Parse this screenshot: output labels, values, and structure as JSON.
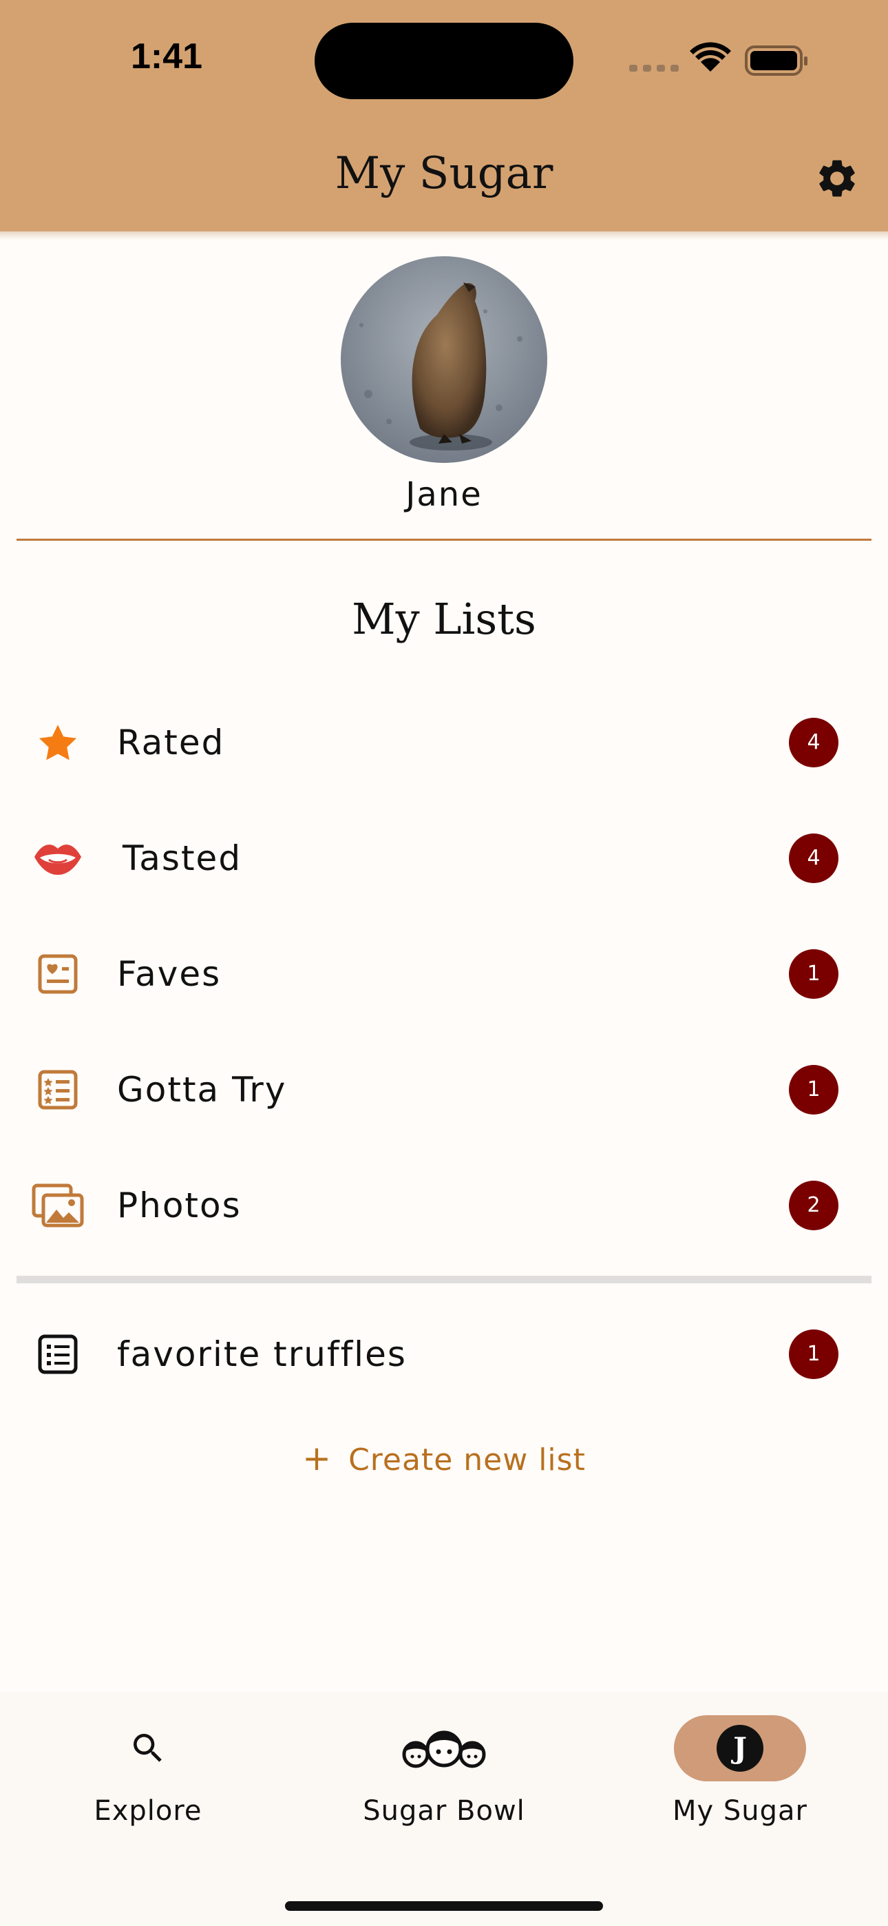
{
  "status_bar": {
    "time": "1:41"
  },
  "header": {
    "title": "My Sugar"
  },
  "profile": {
    "name": "Jane"
  },
  "lists": {
    "title": "My Lists",
    "builtin": [
      {
        "label": "Rated",
        "count": "4",
        "icon": "star-icon",
        "icon_color": "#f57c12"
      },
      {
        "label": "Tasted",
        "count": "4",
        "icon": "lips-icon",
        "icon_color": "#e0403a"
      },
      {
        "label": "Faves",
        "count": "1",
        "icon": "heart-card-icon",
        "icon_color": "#c07a3a"
      },
      {
        "label": "Gotta Try",
        "count": "1",
        "icon": "star-list-icon",
        "icon_color": "#c07a3a"
      },
      {
        "label": "Photos",
        "count": "2",
        "icon": "photos-icon",
        "icon_color": "#c07a3a"
      }
    ],
    "custom": [
      {
        "label": "favorite truffles",
        "count": "1",
        "icon": "list-icon",
        "icon_color": "#111111"
      }
    ],
    "create_label": "Create new list"
  },
  "bottom_nav": {
    "items": [
      {
        "label": "Explore",
        "icon": "search-icon",
        "active": false
      },
      {
        "label": "Sugar Bowl",
        "icon": "faces-icon",
        "active": false
      },
      {
        "label": "My Sugar",
        "icon": "profile-initial-icon",
        "initial": "J",
        "active": true
      }
    ]
  },
  "colors": {
    "header_bg": "#d4a271",
    "badge_bg": "#7a0000",
    "accent": "#b8701f",
    "active_nav_pill": "#cf9b78"
  }
}
